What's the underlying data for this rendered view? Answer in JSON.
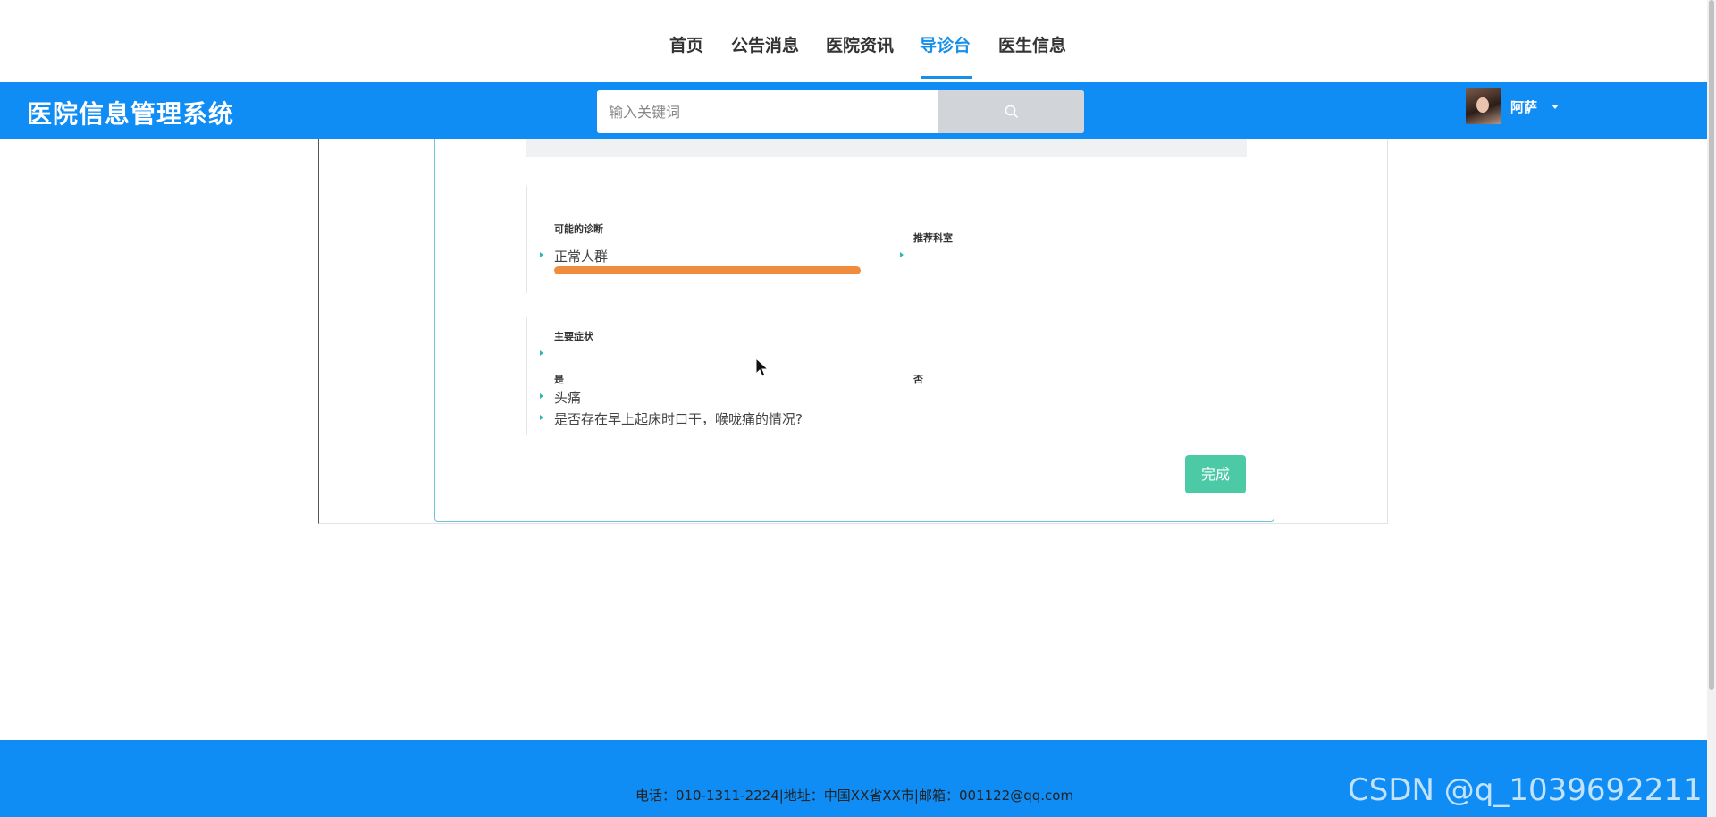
{
  "nav": {
    "items": [
      {
        "label": "首页",
        "active": false
      },
      {
        "label": "公告消息",
        "active": false
      },
      {
        "label": "医院资讯",
        "active": false
      },
      {
        "label": "导诊台",
        "active": true
      },
      {
        "label": "医生信息",
        "active": false
      }
    ]
  },
  "header": {
    "brand": "医院信息管理系统",
    "search": {
      "placeholder": "输入关键词",
      "value": ""
    },
    "user": {
      "name": "阿萨"
    }
  },
  "diagnosis": {
    "possible_label": "可能的诊断",
    "possible_value": "正常人群",
    "progress_fraction": 1.0,
    "recommend_label": "推荐科室",
    "main_symptoms_label": "主要症状",
    "yes_label": "是",
    "no_label": "否",
    "yes_items": [
      "头痛",
      "是否存在早上起床时口干，喉咙痛的情况?"
    ],
    "done_button": "完成"
  },
  "footer": {
    "contact": "电话：010-1311-2224|地址：中国XX省XX市|邮箱：001122@qq.com",
    "watermark": "CSDN @q_1039692211"
  },
  "colors": {
    "primary": "#0f8df5",
    "nav_active": "#1890e8",
    "progress": "#f08c3c",
    "done_button": "#4bcaa5",
    "arrow": "#2fb6b0"
  }
}
